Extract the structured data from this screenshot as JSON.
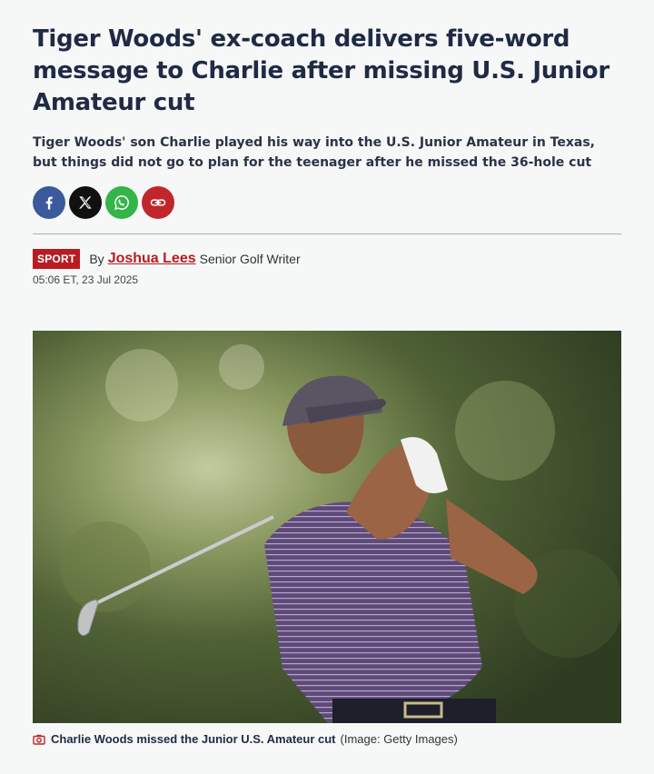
{
  "article": {
    "headline": "Tiger Woods' ex-coach delivers five-word message to Charlie after missing U.S. Junior Amateur cut",
    "standfirst": "Tiger Woods' son Charlie played his way into the U.S. Junior Amateur in Texas, but things did not go to plan for the teenager after he missed the 36-hole cut",
    "section": "SPORT",
    "by_prefix": "By",
    "author": "Joshua Lees",
    "author_role": "Senior Golf Writer",
    "timestamp": "05:06 ET, 23 Jul 2025"
  },
  "share": {
    "icons": [
      "facebook-icon",
      "x-icon",
      "whatsapp-icon",
      "link-icon"
    ]
  },
  "image": {
    "caption": "Charlie Woods missed the Junior U.S. Amateur cut",
    "credit": "(Image: Getty Images)"
  },
  "colors": {
    "brand_red": "#b81c22",
    "headline": "#1f2a44",
    "background": "#f6f7f7"
  }
}
